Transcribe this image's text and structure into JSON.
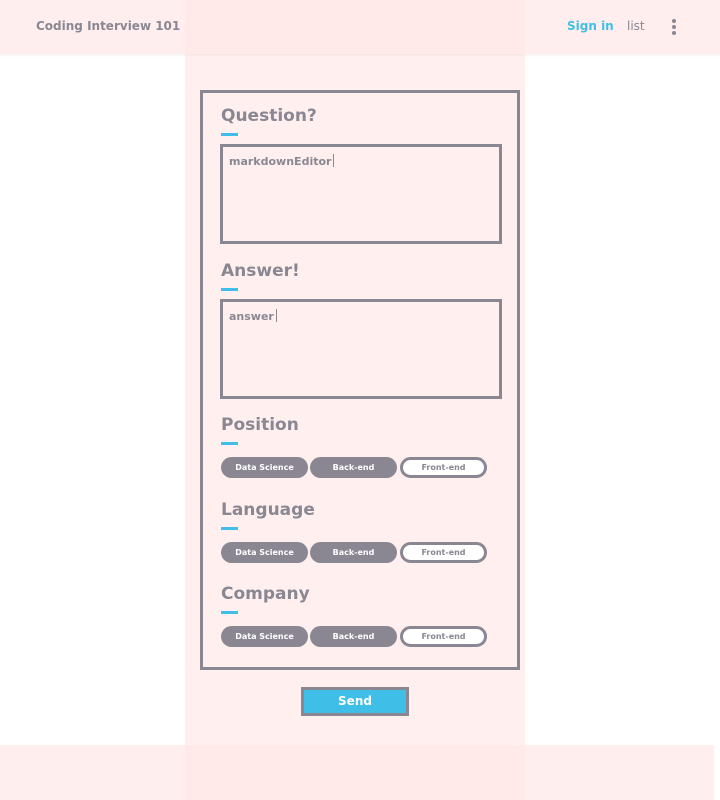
{
  "header": {
    "title": "Coding Interview 101",
    "signin_label": "Sign in",
    "list_label": "list"
  },
  "form": {
    "question": {
      "title": "Question?",
      "editor_text": "markdownEditor"
    },
    "answer": {
      "title": "Answer!",
      "editor_text": "answer"
    },
    "position": {
      "title": "Position",
      "chips": [
        "Data Science",
        "Back-end",
        "Front-end"
      ]
    },
    "language": {
      "title": "Language",
      "chips": [
        "Data Science",
        "Back-end",
        "Front-end"
      ]
    },
    "company": {
      "title": "Company",
      "chips": [
        "Data Science",
        "Back-end",
        "Front-end"
      ]
    },
    "send_label": "Send"
  },
  "colors": {
    "accent": "#3fbfe8",
    "text": "#8a8793",
    "background_tint": "#fff0ef"
  },
  "icons": {
    "menu": "kebab-menu-icon"
  }
}
